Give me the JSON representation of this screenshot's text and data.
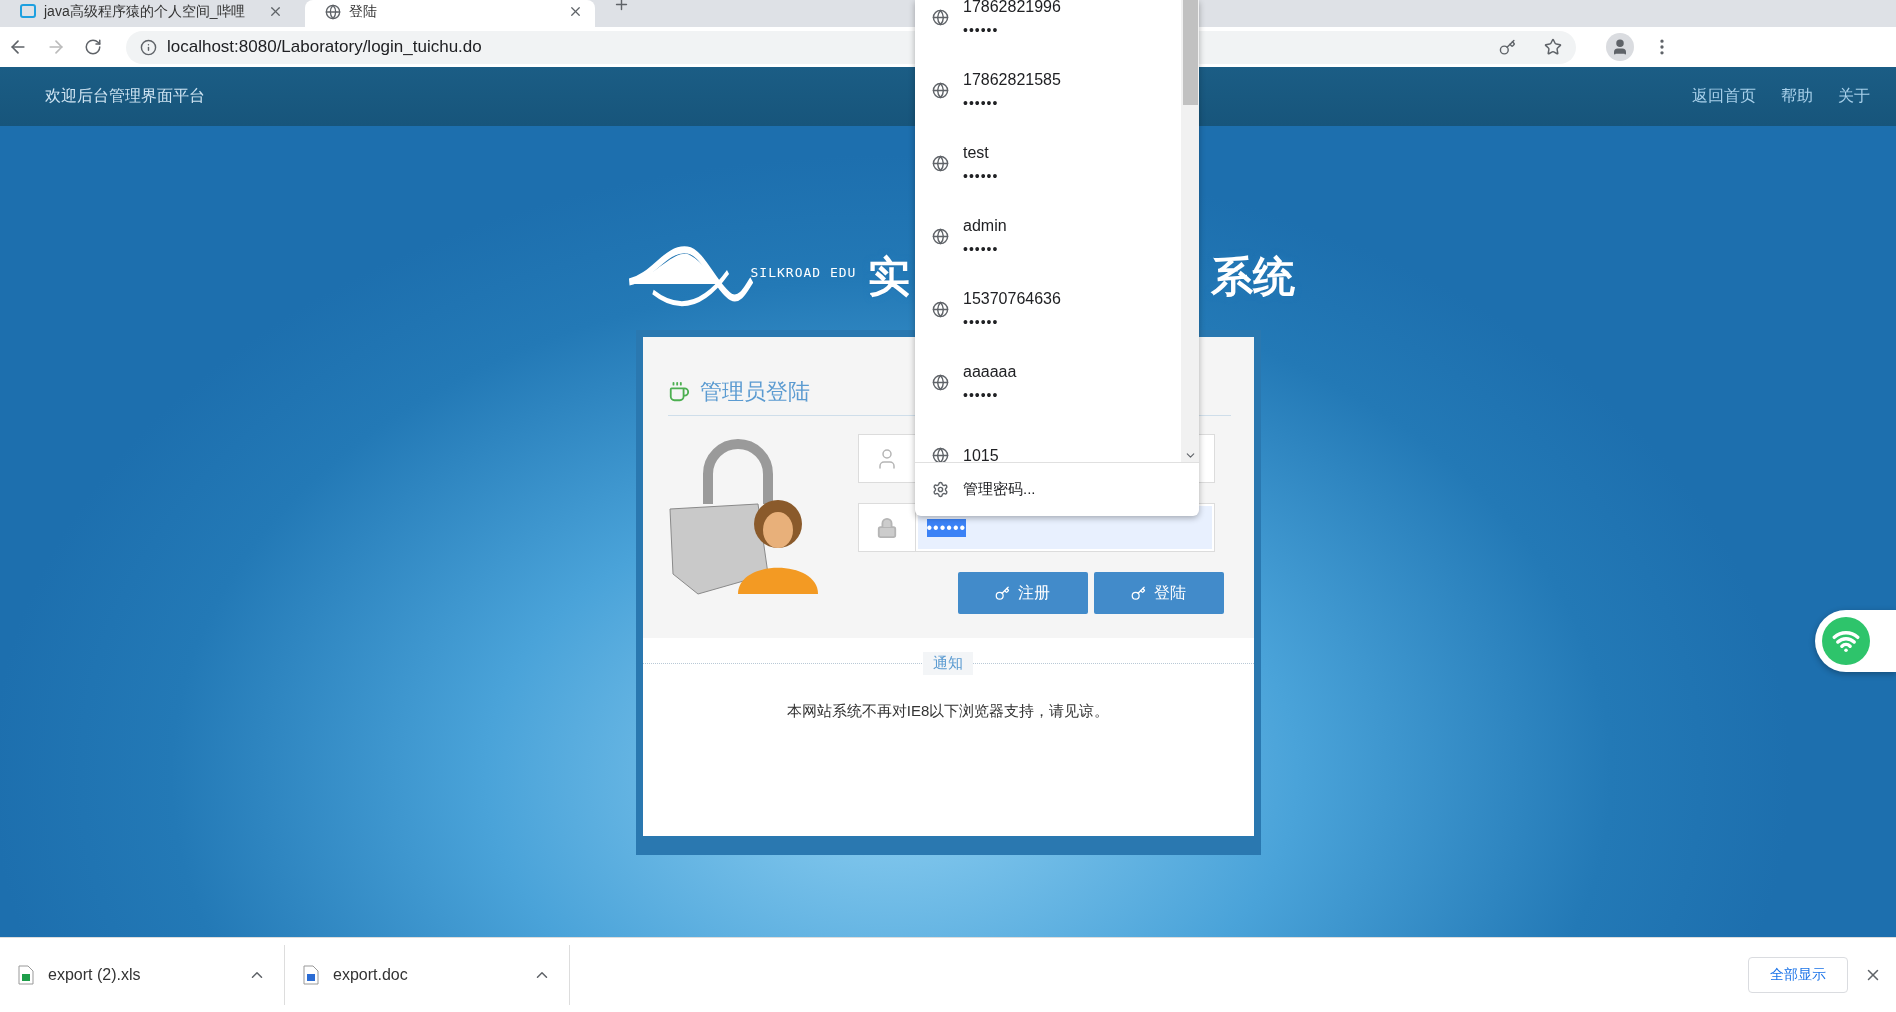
{
  "browser": {
    "tabs": [
      {
        "title": "java高级程序猿的个人空间_哔哩",
        "selected": false
      },
      {
        "title": "登陆",
        "selected": true
      }
    ],
    "url": "localhost:8080/Laboratory/login_tuichu.do"
  },
  "header": {
    "title": "欢迎后台管理界面平台",
    "links": [
      "返回首页",
      "帮助",
      "关于"
    ]
  },
  "logo": {
    "brand": "SILKROAD EDU",
    "title_start": "实",
    "title_end": "系统"
  },
  "login": {
    "heading": "管理员登陆",
    "password": {
      "value": "••••••",
      "autofilled": true
    },
    "buttons": [
      "注册",
      "登陆"
    ],
    "notice": {
      "label": "通知",
      "text": "本网站系统不再对IE8以下浏览器支持，请见谅。"
    }
  },
  "password_dropdown": {
    "entries": [
      {
        "username": "17862821996",
        "password": "••••••"
      },
      {
        "username": "17862821585",
        "password": "••••••"
      },
      {
        "username": "test",
        "password": "••••••"
      },
      {
        "username": "admin",
        "password": "••••••"
      },
      {
        "username": "15370764636",
        "password": "••••••"
      },
      {
        "username": "aaaaaa",
        "password": "••••••"
      },
      {
        "username": "1015"
      }
    ],
    "footer": "管理密码..."
  },
  "downloads": {
    "files": [
      {
        "name": "export (2).xls",
        "kind": "xls"
      },
      {
        "name": "export.doc",
        "kind": "doc"
      }
    ],
    "show_all": "全部显示"
  }
}
